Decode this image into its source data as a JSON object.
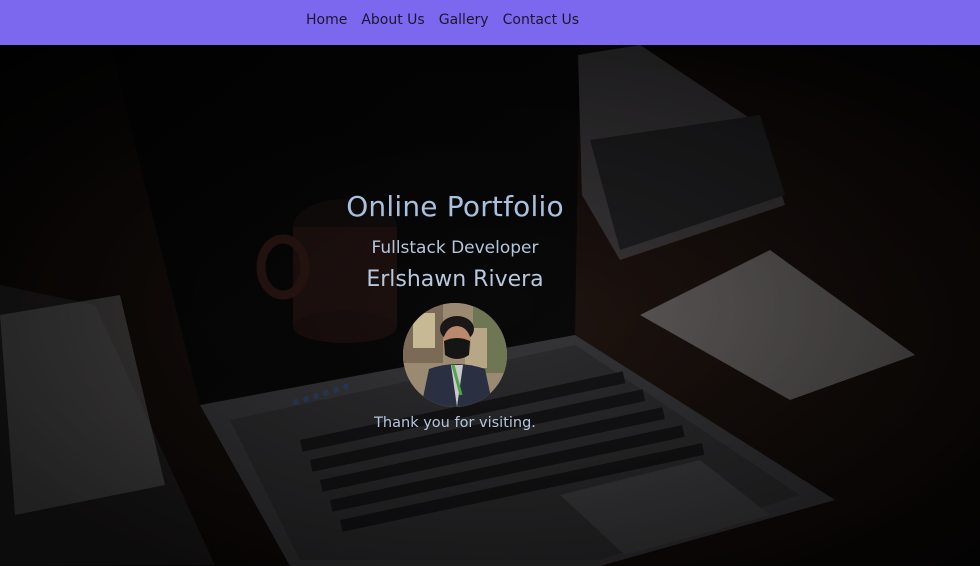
{
  "nav": {
    "items": [
      {
        "label": "Home"
      },
      {
        "label": "About Us"
      },
      {
        "label": "Gallery"
      },
      {
        "label": "Contact Us"
      }
    ]
  },
  "hero": {
    "title": "Online Portfolio",
    "subtitle": "Fullstack Developer",
    "name": "Erlshawn Rivera",
    "thanks": "Thank you for visiting."
  },
  "colors": {
    "navbar": "#7b68ee",
    "hero_text": "#a9c1de"
  }
}
